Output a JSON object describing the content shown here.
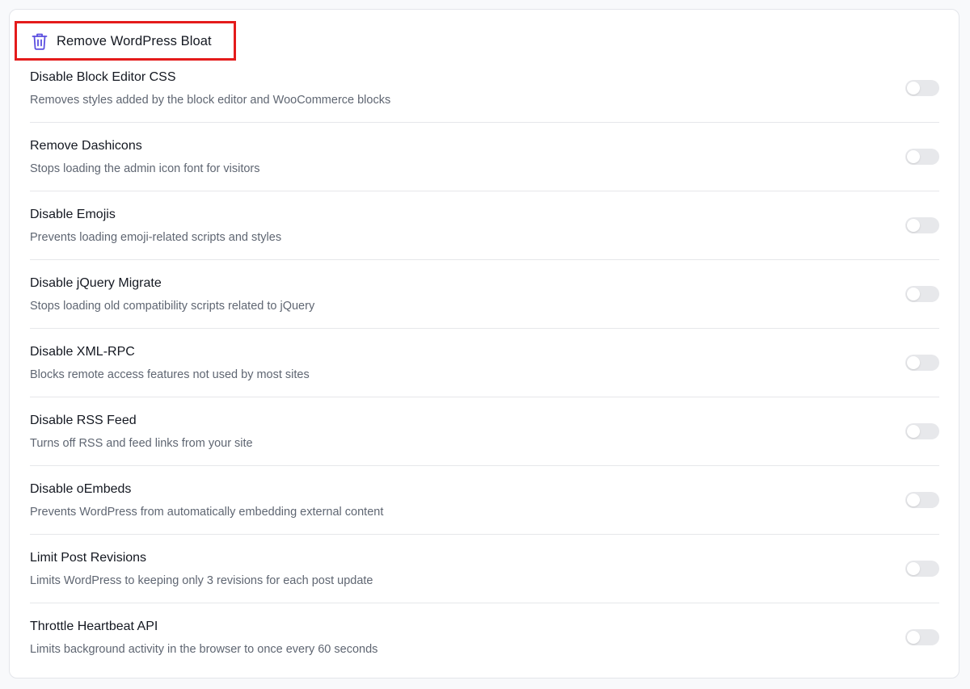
{
  "header": {
    "title": "Remove WordPress Bloat",
    "icon": "trash-icon",
    "icon_color": "#5b4fe0",
    "highlight_color": "#e41b1b"
  },
  "settings": [
    {
      "label": "Disable Block Editor CSS",
      "description": "Removes styles added by the block editor and WooCommerce blocks",
      "enabled": false
    },
    {
      "label": "Remove Dashicons",
      "description": "Stops loading the admin icon font for visitors",
      "enabled": false
    },
    {
      "label": "Disable Emojis",
      "description": "Prevents loading emoji-related scripts and styles",
      "enabled": false
    },
    {
      "label": "Disable jQuery Migrate",
      "description": "Stops loading old compatibility scripts related to jQuery",
      "enabled": false
    },
    {
      "label": "Disable XML-RPC",
      "description": "Blocks remote access features not used by most sites",
      "enabled": false
    },
    {
      "label": "Disable RSS Feed",
      "description": "Turns off RSS and feed links from your site",
      "enabled": false
    },
    {
      "label": "Disable oEmbeds",
      "description": "Prevents WordPress from automatically embedding external content",
      "enabled": false
    },
    {
      "label": "Limit Post Revisions",
      "description": "Limits WordPress to keeping only 3 revisions for each post update",
      "enabled": false
    },
    {
      "label": "Throttle Heartbeat API",
      "description": "Limits background activity in the browser to once every 60 seconds",
      "enabled": false
    }
  ]
}
